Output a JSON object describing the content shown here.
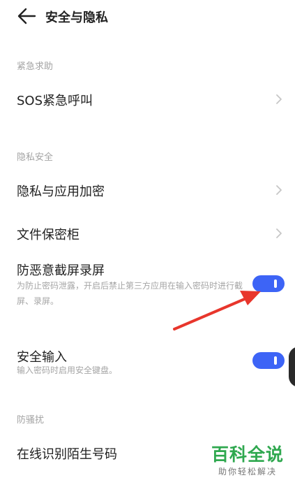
{
  "header": {
    "title": "安全与隐私",
    "back_icon": "arrow-left-icon"
  },
  "sections": {
    "emergency": {
      "label": "紧急求助"
    },
    "privacy": {
      "label": "隐私安全"
    },
    "harassment": {
      "label": "防骚扰"
    }
  },
  "rows": {
    "sos": {
      "title": "SOS紧急呼叫"
    },
    "app_lock": {
      "title": "隐私与应用加密"
    },
    "file_safe": {
      "title": "文件保密柜"
    },
    "anti_screenshot": {
      "title": "防恶意截屏录屏",
      "desc": "为防止密码泄露，开启后禁止第三方应用在输入密码时进行截屏、录屏。",
      "enabled": true
    },
    "secure_input": {
      "title": "安全输入",
      "desc": "输入密码时启用安全键盘。",
      "enabled": true
    },
    "stranger_id": {
      "title": "在线识别陌生号码"
    }
  },
  "colors": {
    "toggle_on": "#3d64f6",
    "annotation_arrow": "#e8362c",
    "watermark": "#2fa84f"
  },
  "watermark": {
    "main": "百科全说",
    "sub": "助你轻松解决"
  }
}
